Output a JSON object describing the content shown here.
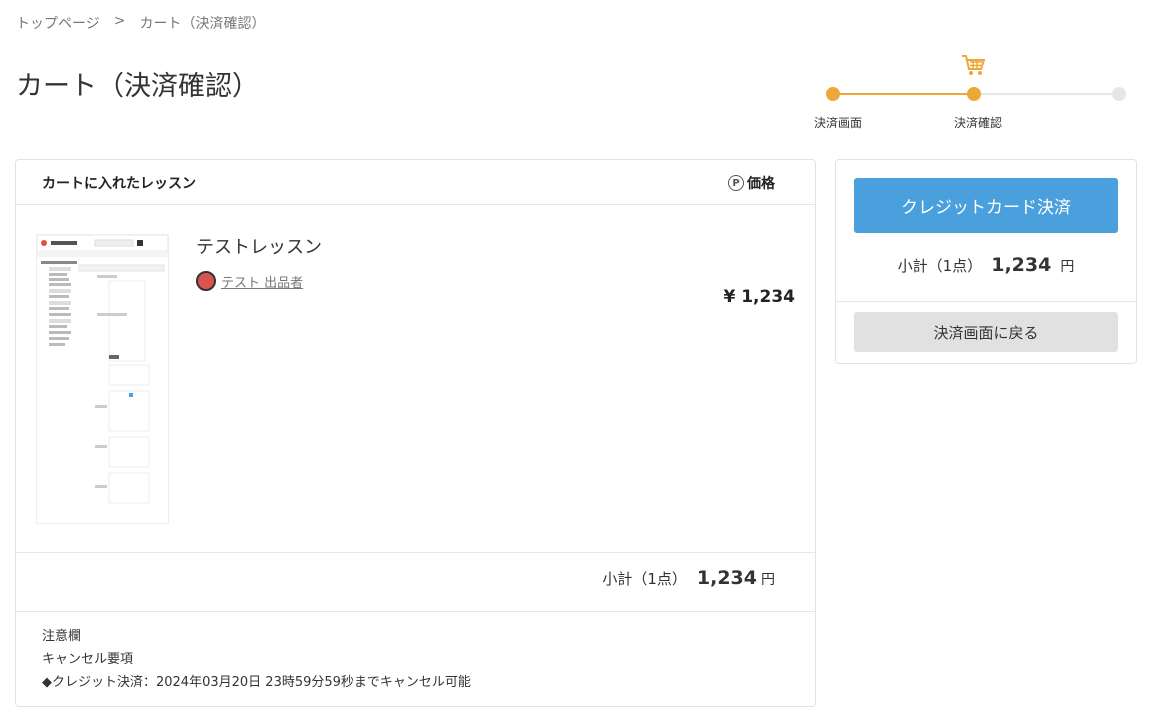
{
  "breadcrumb": {
    "home": "トップページ",
    "sep": ">",
    "current": "カート（決済確認）"
  },
  "page_title": "カート（決済確認）",
  "steps": {
    "step1": "決済画面",
    "step2": "決済確認",
    "current_step": 2,
    "total_steps": 3,
    "accent": "#f0a73a"
  },
  "cart": {
    "header": "カートに入れたレッスン",
    "price_header": "価格",
    "price_icon": "P",
    "item": {
      "name": "テストレッスン",
      "seller": "テスト 出品者",
      "price": "¥ 1,234"
    },
    "subtotal": {
      "label": "小計（1点）",
      "value": "1,234",
      "unit": "円"
    },
    "notes": {
      "title": "注意欄",
      "line1": "キャンセル要項",
      "line2": "◆クレジット決済：2024年03月20日 23時59分59秒までキャンセル可能"
    }
  },
  "side": {
    "pay_button": "クレジットカード決済",
    "subtotal": {
      "label": "小計（1点）",
      "value": "1,234",
      "unit": "円"
    },
    "back_button": "決済画面に戻る",
    "pay_color": "#4aa0dc"
  }
}
